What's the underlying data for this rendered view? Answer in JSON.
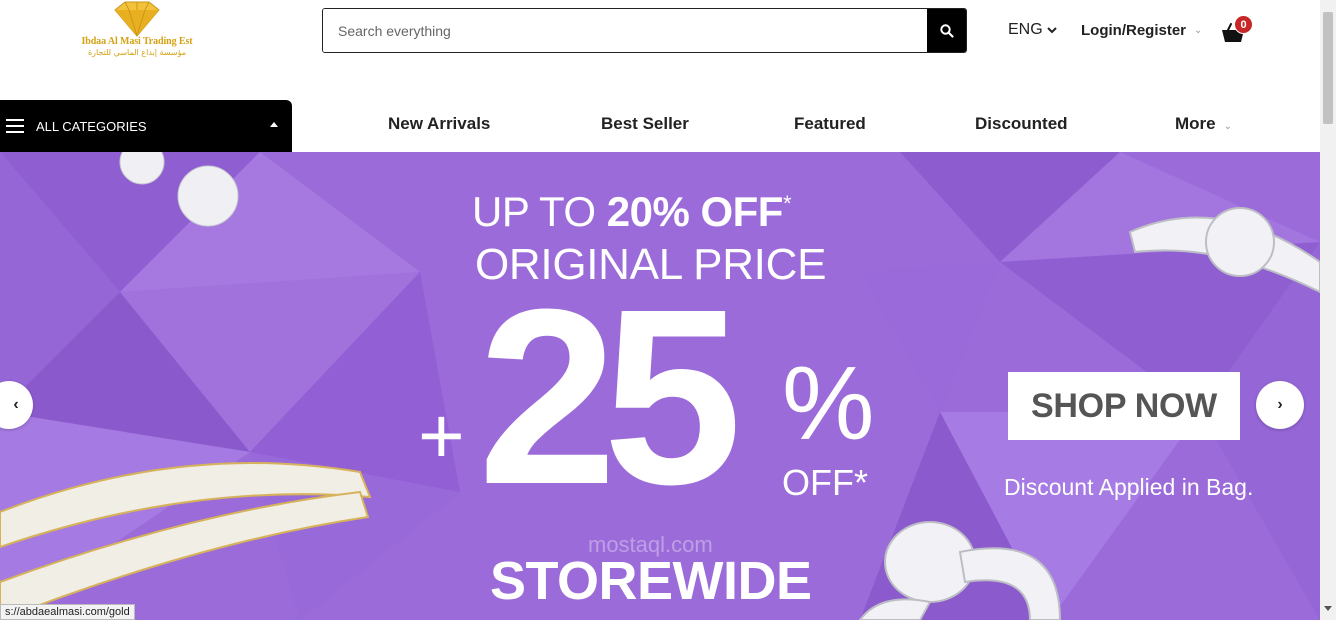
{
  "logo": {
    "name_en": "Ibdaa Al Masi Trading Est",
    "name_ar": "مؤسسة إبداع الماسي للتجارة",
    "color": "#d4a215"
  },
  "search": {
    "placeholder": "Search everything",
    "icon": "search-icon"
  },
  "language": {
    "label": "ENG"
  },
  "account": {
    "label": "Login/Register"
  },
  "cart": {
    "count": "0",
    "icon": "cart-icon"
  },
  "categories": {
    "label": "ALL CATEGORIES"
  },
  "nav": {
    "new_arrivals": "New Arrivals",
    "best_seller": "Best Seller",
    "featured": "Featured",
    "discounted": "Discounted",
    "more": "More"
  },
  "hero": {
    "line1_pre": "UP TO ",
    "line1_bold": "20% OFF",
    "line1_star": "*",
    "line2": "ORIGINAL PRICE",
    "plus": "+",
    "big": "25",
    "percent": "%",
    "off": "OFF*",
    "storewide": "STOREWIDE",
    "cta": "SHOP NOW",
    "note": "Discount Applied in Bag.",
    "watermark": "mostaql.com",
    "bg_color": "#9b6bd9"
  },
  "status_bar": {
    "url": "s://abdaealmasi.com/gold"
  },
  "colors": {
    "accent": "#000000",
    "badge": "#c62828"
  }
}
